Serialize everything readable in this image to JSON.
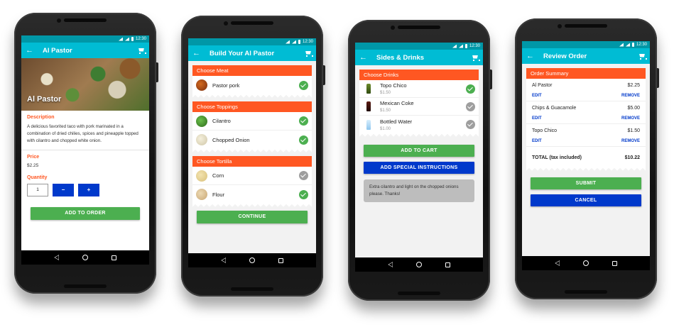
{
  "status": {
    "time": "12:30"
  },
  "colors": {
    "primary": "#00bcd4",
    "status_bar": "#0097a7",
    "accent": "#ff5722",
    "button_green": "#4caf50",
    "button_blue": "#0039cb",
    "check_off": "#9e9e9e"
  },
  "screen1": {
    "title": "Al Pastor",
    "hero_title": "Al Pastor",
    "description_label": "Description",
    "description": "A delicious favorited taco with pork marinated in a combination of dried chilies, spices and pineapple topped with cilantro and chopped white onion.",
    "price_label": "Price",
    "price": "$2.25",
    "quantity_label": "Quantity",
    "quantity_value": "1",
    "minus_label": "−",
    "plus_label": "+",
    "add_label": "ADD TO ORDER"
  },
  "screen2": {
    "title": "Build Your Al Pastor",
    "meat_header": "Choose Meat",
    "meat": [
      {
        "label": "Pastor pork",
        "checked": true,
        "icon": "pork-thumbnail"
      }
    ],
    "toppings_header": "Choose Toppings",
    "toppings": [
      {
        "label": "Cilantro",
        "checked": true,
        "icon": "cilantro-thumbnail"
      },
      {
        "label": "Chopped Onion",
        "checked": true,
        "icon": "onion-thumbnail"
      }
    ],
    "tortilla_header": "Choose Tortilla",
    "tortillas": [
      {
        "label": "Corn",
        "checked": false,
        "icon": "corn-tortilla-thumbnail"
      },
      {
        "label": "Flour",
        "checked": true,
        "icon": "flour-tortilla-thumbnail"
      }
    ],
    "continue_label": "CONTINUE"
  },
  "screen3": {
    "title": "Sides & Drinks",
    "drinks_header": "Choose Drinks",
    "drinks": [
      {
        "label": "Topo Chico",
        "price": "$1.50",
        "checked": true,
        "icon": "topo-chico-bottle"
      },
      {
        "label": "Mexican Coke",
        "price": "$1.50",
        "checked": false,
        "icon": "coke-bottle"
      },
      {
        "label": "Bottled Water",
        "price": "$1.00",
        "checked": false,
        "icon": "water-bottle"
      }
    ],
    "add_to_cart_label": "ADD TO CART",
    "special_label": "ADD SPECIAL INSTRUCTIONS",
    "instructions_text": "Extra cilantro and light on the chopped onions please. Thanks!"
  },
  "screen4": {
    "title": "Review Order",
    "summary_header": "Order Summary",
    "items": [
      {
        "name": "Al Pastor",
        "price": "$2.25",
        "edit": "EDIT",
        "remove": "REMOVE"
      },
      {
        "name": "Chips & Guacamole",
        "price": "$5.00",
        "edit": "EDIT",
        "remove": "REMOVE"
      },
      {
        "name": "Topo Chico",
        "price": "$1.50",
        "edit": "EDIT",
        "remove": "REMOVE"
      }
    ],
    "total_label": "TOTAL (tax included)",
    "total_value": "$10.22",
    "submit_label": "SUBMIT",
    "cancel_label": "CANCEL"
  }
}
